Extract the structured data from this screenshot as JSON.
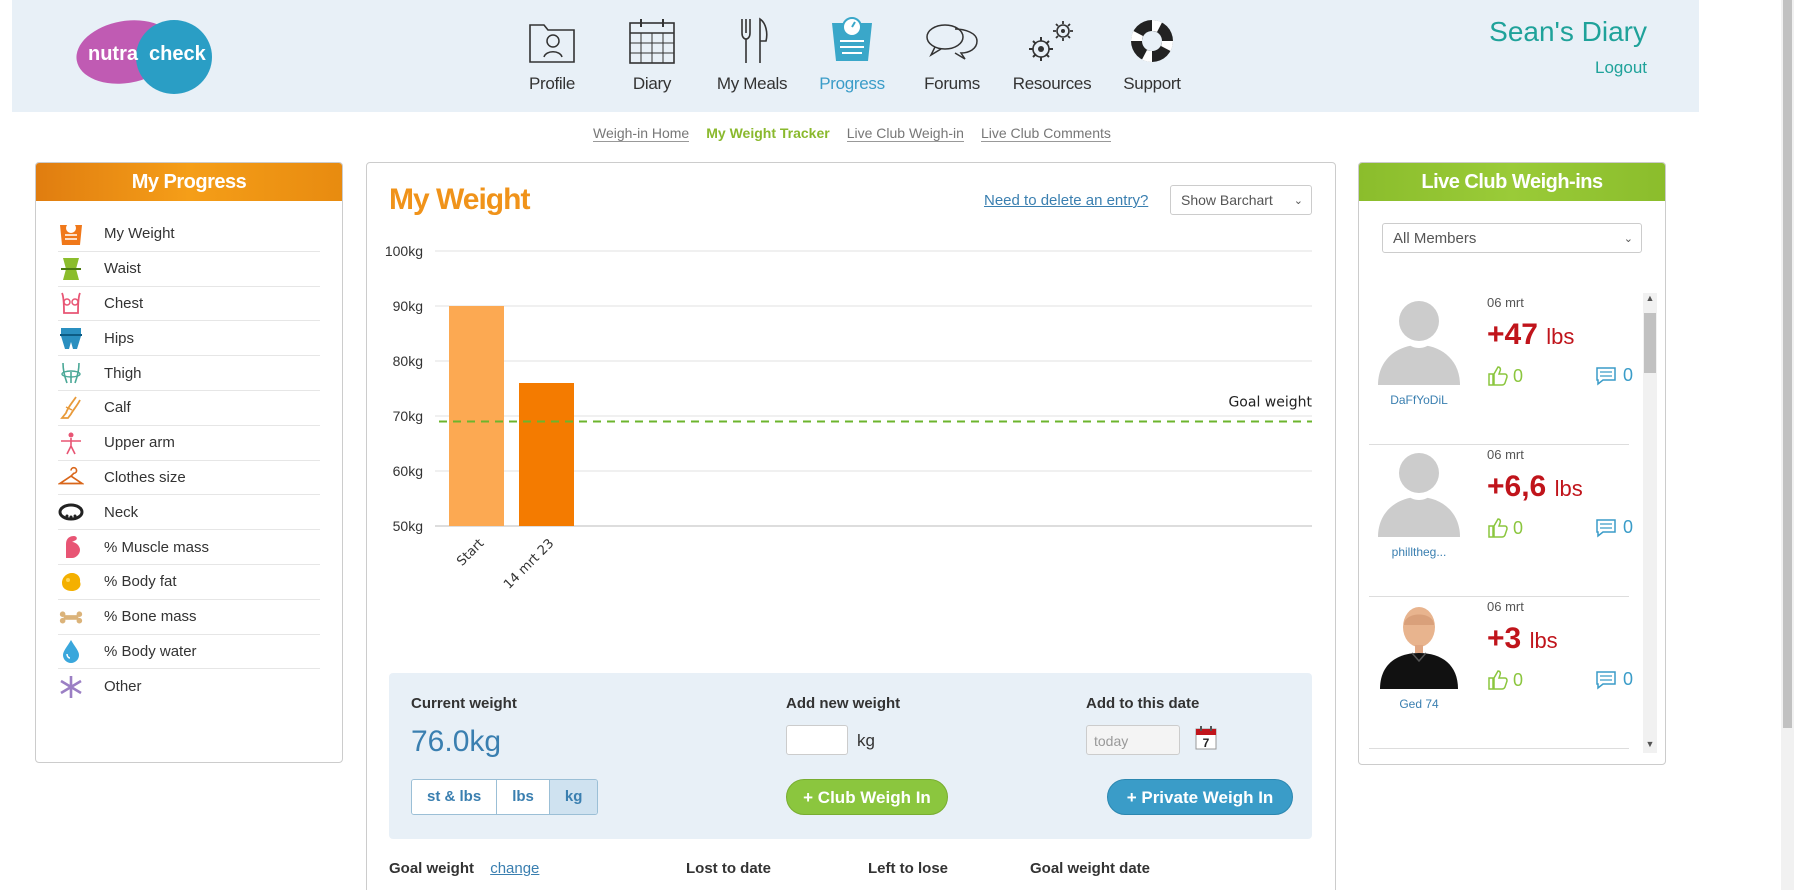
{
  "header": {
    "logo_text_left": "nutra",
    "logo_text_right": "check",
    "diary_title": "Sean's Diary",
    "logout": "Logout",
    "nav": [
      {
        "label": "Profile",
        "icon": "profile-folder-icon"
      },
      {
        "label": "Diary",
        "icon": "calendar-icon"
      },
      {
        "label": "My Meals",
        "icon": "fork-knife-icon"
      },
      {
        "label": "Progress",
        "icon": "scale-icon",
        "active": true
      },
      {
        "label": "Forums",
        "icon": "chat-bubbles-icon"
      },
      {
        "label": "Resources",
        "icon": "gears-icon"
      },
      {
        "label": "Support",
        "icon": "lifebuoy-icon"
      }
    ]
  },
  "subnav": [
    {
      "label": "Weigh-in Home"
    },
    {
      "label": "My Weight Tracker",
      "active": true
    },
    {
      "label": "Live Club Weigh-in"
    },
    {
      "label": "Live Club Comments"
    }
  ],
  "left_panel": {
    "title": "My Progress",
    "items": [
      {
        "label": "My Weight",
        "icon": "scale-icon"
      },
      {
        "label": "Waist",
        "icon": "waist-icon"
      },
      {
        "label": "Chest",
        "icon": "chest-icon"
      },
      {
        "label": "Hips",
        "icon": "hips-icon"
      },
      {
        "label": "Thigh",
        "icon": "thigh-icon"
      },
      {
        "label": "Calf",
        "icon": "calf-icon"
      },
      {
        "label": "Upper arm",
        "icon": "upper-arm-icon"
      },
      {
        "label": "Clothes size",
        "icon": "hanger-icon"
      },
      {
        "label": "Neck",
        "icon": "neck-icon"
      },
      {
        "label": "% Muscle mass",
        "icon": "muscle-icon"
      },
      {
        "label": "% Body fat",
        "icon": "body-fat-icon"
      },
      {
        "label": "% Bone mass",
        "icon": "bone-icon"
      },
      {
        "label": "% Body water",
        "icon": "water-drop-icon"
      },
      {
        "label": "Other",
        "icon": "asterisk-icon"
      }
    ]
  },
  "main": {
    "title": "My Weight",
    "delete_link": "Need to delete an entry?",
    "chart_select": "Show Barchart",
    "current_weight_label": "Current weight",
    "current_weight_value": "76.0kg",
    "add_weight_label": "Add new weight",
    "add_weight_unit": "kg",
    "add_date_label": "Add to this date",
    "date_placeholder": "today",
    "calendar_day": "7",
    "unit_tabs": [
      {
        "label": "st & lbs"
      },
      {
        "label": "lbs"
      },
      {
        "label": "kg",
        "active": true
      }
    ],
    "club_button": "+ Club Weigh In",
    "private_button": "+ Private Weigh In",
    "goal_weight_label": "Goal weight",
    "change_link": "change",
    "lost_label": "Lost to date",
    "left_label": "Left to lose",
    "goal_date_label": "Goal weight date"
  },
  "chart_data": {
    "type": "bar",
    "categories": [
      "Start",
      "14 mrt 23"
    ],
    "values": [
      90,
      76
    ],
    "ylim": [
      50,
      100
    ],
    "yticks": [
      "50kg",
      "60kg",
      "70kg",
      "80kg",
      "90kg",
      "100kg"
    ],
    "ytick_values": [
      50,
      60,
      70,
      80,
      90,
      100
    ],
    "goal_value": 69,
    "goal_label": "Goal weight",
    "colors": [
      "#fca952",
      "#f47b00"
    ],
    "goal_color": "#6cb52d",
    "grid": true
  },
  "right_panel": {
    "title": "Live Club Weigh-ins",
    "members_select": "All Members",
    "feed": [
      {
        "name": "DaFfYoDiL",
        "date": "06 mrt",
        "value": "+47",
        "unit": "lbs",
        "likes": "0",
        "comments": "0",
        "avatar": "default"
      },
      {
        "name": "philltheg...",
        "date": "06 mrt",
        "value": "+6,6",
        "unit": "lbs",
        "likes": "0",
        "comments": "0",
        "avatar": "default"
      },
      {
        "name": "Ged 74",
        "date": "06 mrt",
        "value": "+3",
        "unit": "lbs",
        "likes": "0",
        "comments": "0",
        "avatar": "person"
      }
    ]
  }
}
